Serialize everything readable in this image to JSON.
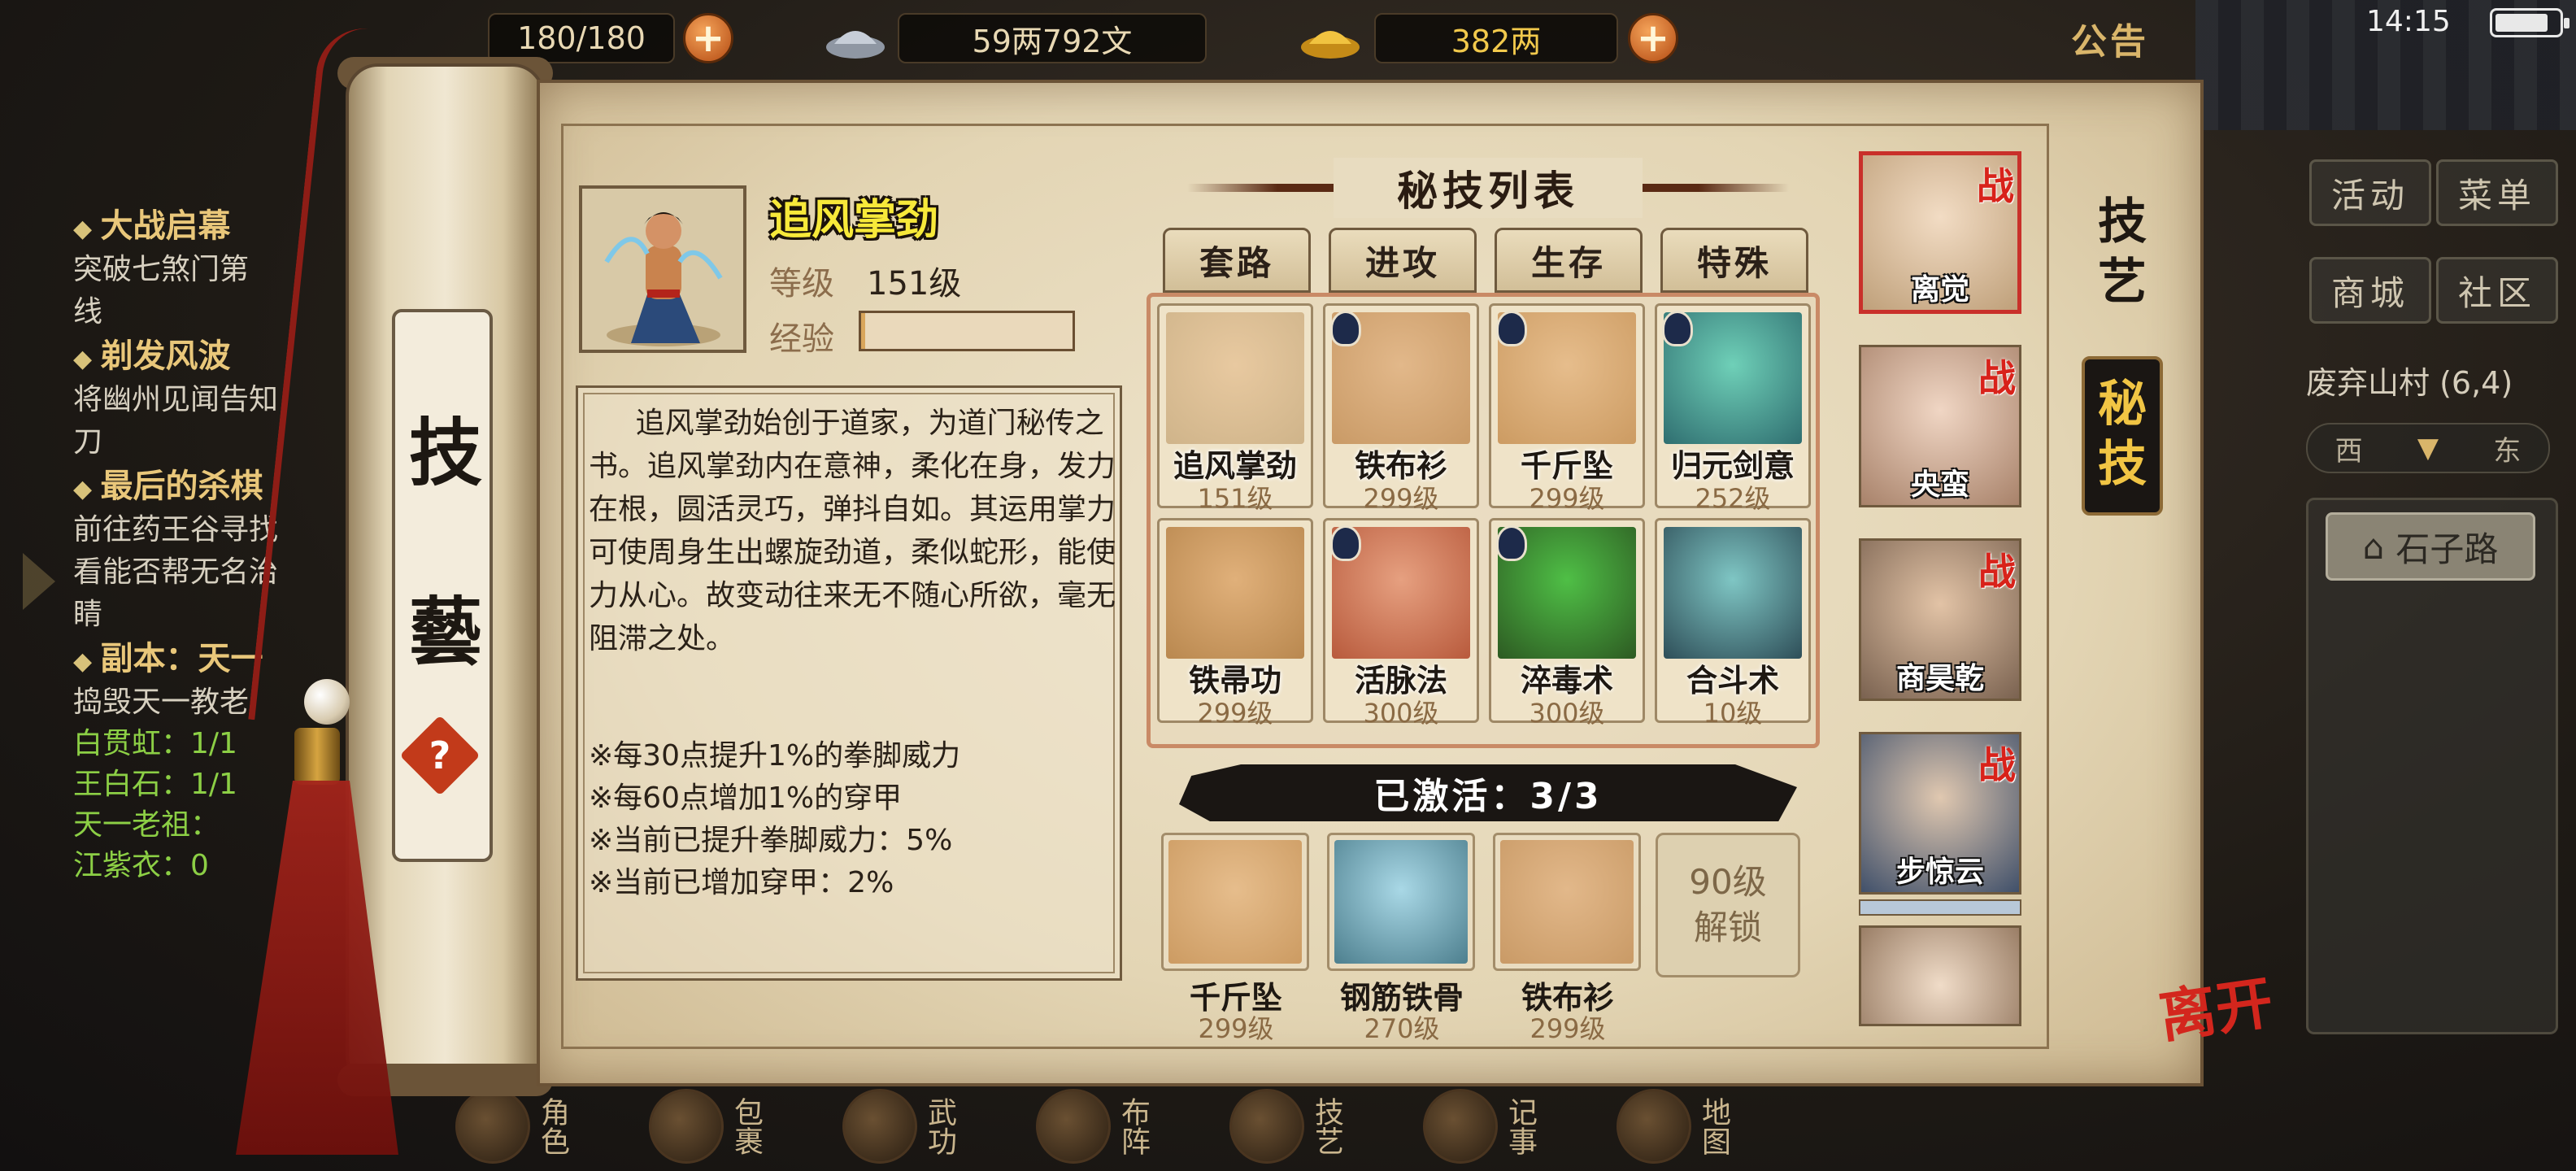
{
  "topbar": {
    "stamina": "180/180",
    "silver": "59两792文",
    "gold": "382两",
    "notice_label": "公告",
    "time": "14:15",
    "plus_symbol": "+"
  },
  "quests": [
    {
      "title": "大战启幕",
      "desc": "突破七煞门第",
      "desc2": "线"
    },
    {
      "title": "剃发风波",
      "desc": "将幽州见闻告知",
      "desc2": "刀"
    },
    {
      "title": "最后的杀棋",
      "desc": "前往药王谷寻找",
      "desc2": "看能否帮无名治",
      "desc3": "睛"
    },
    {
      "title": "副本：天一",
      "desc": "捣毁天一教老"
    }
  ],
  "quest_progress": [
    "白贯虹：1/1",
    "王白石：1/1",
    "天一老祖：",
    "江紫衣：0"
  ],
  "scroll": {
    "char1": "技",
    "char2": "藝",
    "help": "?"
  },
  "selected_skill": {
    "name": "追风掌劲",
    "level_label": "等级",
    "level": "151级",
    "exp_label": "经验",
    "exp_progress": 0.02,
    "description": "追风掌劲始创于道家，为道门秘传之书。追风掌劲内在意神，柔化在身，发力在根，圆活灵巧，弹抖自如。其运用掌力可使周身生出螺旋劲道，柔似蛇形，能使力从心。故变动往来无不随心所欲，毫无阻滞之处。",
    "effects": [
      "※每30点提升1%的拳脚威力",
      "※每60点增加1%的穿甲",
      "※当前已提升拳脚威力：5%",
      "※当前已增加穿甲：2%"
    ]
  },
  "skill_list": {
    "title": "秘技列表",
    "tabs": [
      "套路",
      "进攻",
      "生存",
      "特殊"
    ],
    "skills": [
      {
        "name": "追风掌劲",
        "level": "151级"
      },
      {
        "name": "铁布衫",
        "level": "299级"
      },
      {
        "name": "千斤坠",
        "level": "299级"
      },
      {
        "name": "归元剑意",
        "level": "252级"
      },
      {
        "name": "铁帚功",
        "level": "299级"
      },
      {
        "name": "活脉法",
        "level": "300级"
      },
      {
        "name": "淬毒术",
        "level": "300级"
      },
      {
        "name": "合斗术",
        "level": "10级"
      }
    ]
  },
  "activated": {
    "label": "已激活：3/3",
    "equipped": [
      {
        "name": "千斤坠",
        "level": "299级"
      },
      {
        "name": "钢筋铁骨",
        "level": "270级"
      },
      {
        "name": "铁布衫",
        "level": "299级"
      }
    ],
    "locked_line1": "90级",
    "locked_line2": "解锁"
  },
  "characters": [
    {
      "name": "离觉",
      "tag": "战"
    },
    {
      "name": "央蛮",
      "tag": "战"
    },
    {
      "name": "商昊乾",
      "tag": "战"
    },
    {
      "name": "步惊云",
      "tag": "战"
    },
    {
      "name": "",
      "tag": ""
    }
  ],
  "side_tabs": [
    "技艺",
    "秘技"
  ],
  "right_panel": {
    "buttons": [
      "活动",
      "菜单",
      "商城",
      "社区"
    ],
    "location": "废弃山村 (6,4)",
    "directions": [
      "西",
      "东"
    ],
    "road": "石子路",
    "leave": "离开"
  },
  "bottom_nav": [
    "角色",
    "包裹",
    "武功",
    "布阵",
    "技艺",
    "记事",
    "地图"
  ],
  "colors": {
    "accent_red": "#c9302a",
    "gold_text": "#f7e93a",
    "parchment": "#e3d5b4"
  }
}
